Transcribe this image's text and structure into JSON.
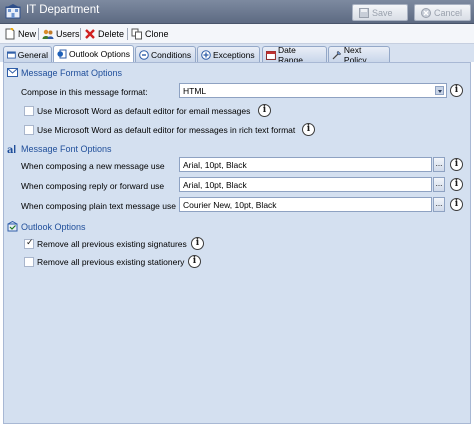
{
  "window": {
    "title": "IT Department",
    "save_label": "Save",
    "cancel_label": "Cancel"
  },
  "toolbar": {
    "new_label": "New",
    "users_label": "Users",
    "delete_label": "Delete",
    "clone_label": "Clone"
  },
  "tabs": [
    {
      "label": "General"
    },
    {
      "label": "Outlook Options",
      "active": true
    },
    {
      "label": "Conditions"
    },
    {
      "label": "Exceptions"
    },
    {
      "label": "Date Range"
    },
    {
      "label": "Next Policy"
    }
  ],
  "message_format": {
    "header": "Message Format Options",
    "compose_label": "Compose in this message format:",
    "compose_value": "HTML",
    "word_editor_email_label": "Use Microsoft Word as default editor for email messages",
    "word_editor_email_checked": false,
    "word_editor_rtf_label": "Use Microsoft Word as default editor for messages in rich text format",
    "word_editor_rtf_checked": false
  },
  "message_font": {
    "header": "Message Font Options",
    "new_label": "When composing a new message use",
    "new_value": "Arial, 10pt,  Black",
    "reply_label": "When composing reply or forward use",
    "reply_value": "Arial, 10pt,  Black",
    "plain_label": "When composing plain text message use",
    "plain_value": "Courier New, 10pt,  Black"
  },
  "outlook_options": {
    "header": "Outlook Options",
    "remove_signatures_label": "Remove all previous existing signatures",
    "remove_signatures_checked": true,
    "remove_stationery_label": "Remove all previous existing stationery",
    "remove_stationery_checked": false
  },
  "icons": {
    "info": "i",
    "ellipsis": "..."
  }
}
